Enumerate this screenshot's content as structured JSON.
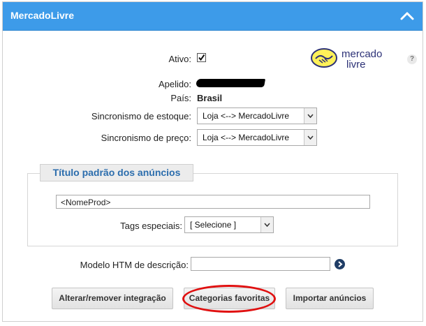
{
  "header": {
    "title": "MercadoLivre"
  },
  "form": {
    "ativo_label": "Ativo:",
    "apelido_label": "Apelido:",
    "pais_label": "País:",
    "pais_value": "Brasil",
    "estoque_label": "Sincronismo de estoque:",
    "estoque_value": "Loja <--> MercadoLivre",
    "preco_label": "Sincronismo de preço:",
    "preco_value": "Loja <--> MercadoLivre"
  },
  "logo": {
    "line1": "mercado",
    "line2": "livre"
  },
  "help": {
    "symbol": "?"
  },
  "titulo_section": {
    "legend": "Título padrão dos anúncios",
    "input_value": "<NomeProd>",
    "tags_label": "Tags especiais:",
    "tags_value": "[ Selecione ]"
  },
  "modelo": {
    "label": "Modelo HTM de descrição:"
  },
  "buttons": {
    "alterar": "Alterar/remover integração",
    "categorias": "Categorias favoritas",
    "importar": "Importar anúncios"
  },
  "colors": {
    "header_bg": "#3d9be9",
    "legend_text": "#2b6dad",
    "highlight": "#e01010"
  }
}
